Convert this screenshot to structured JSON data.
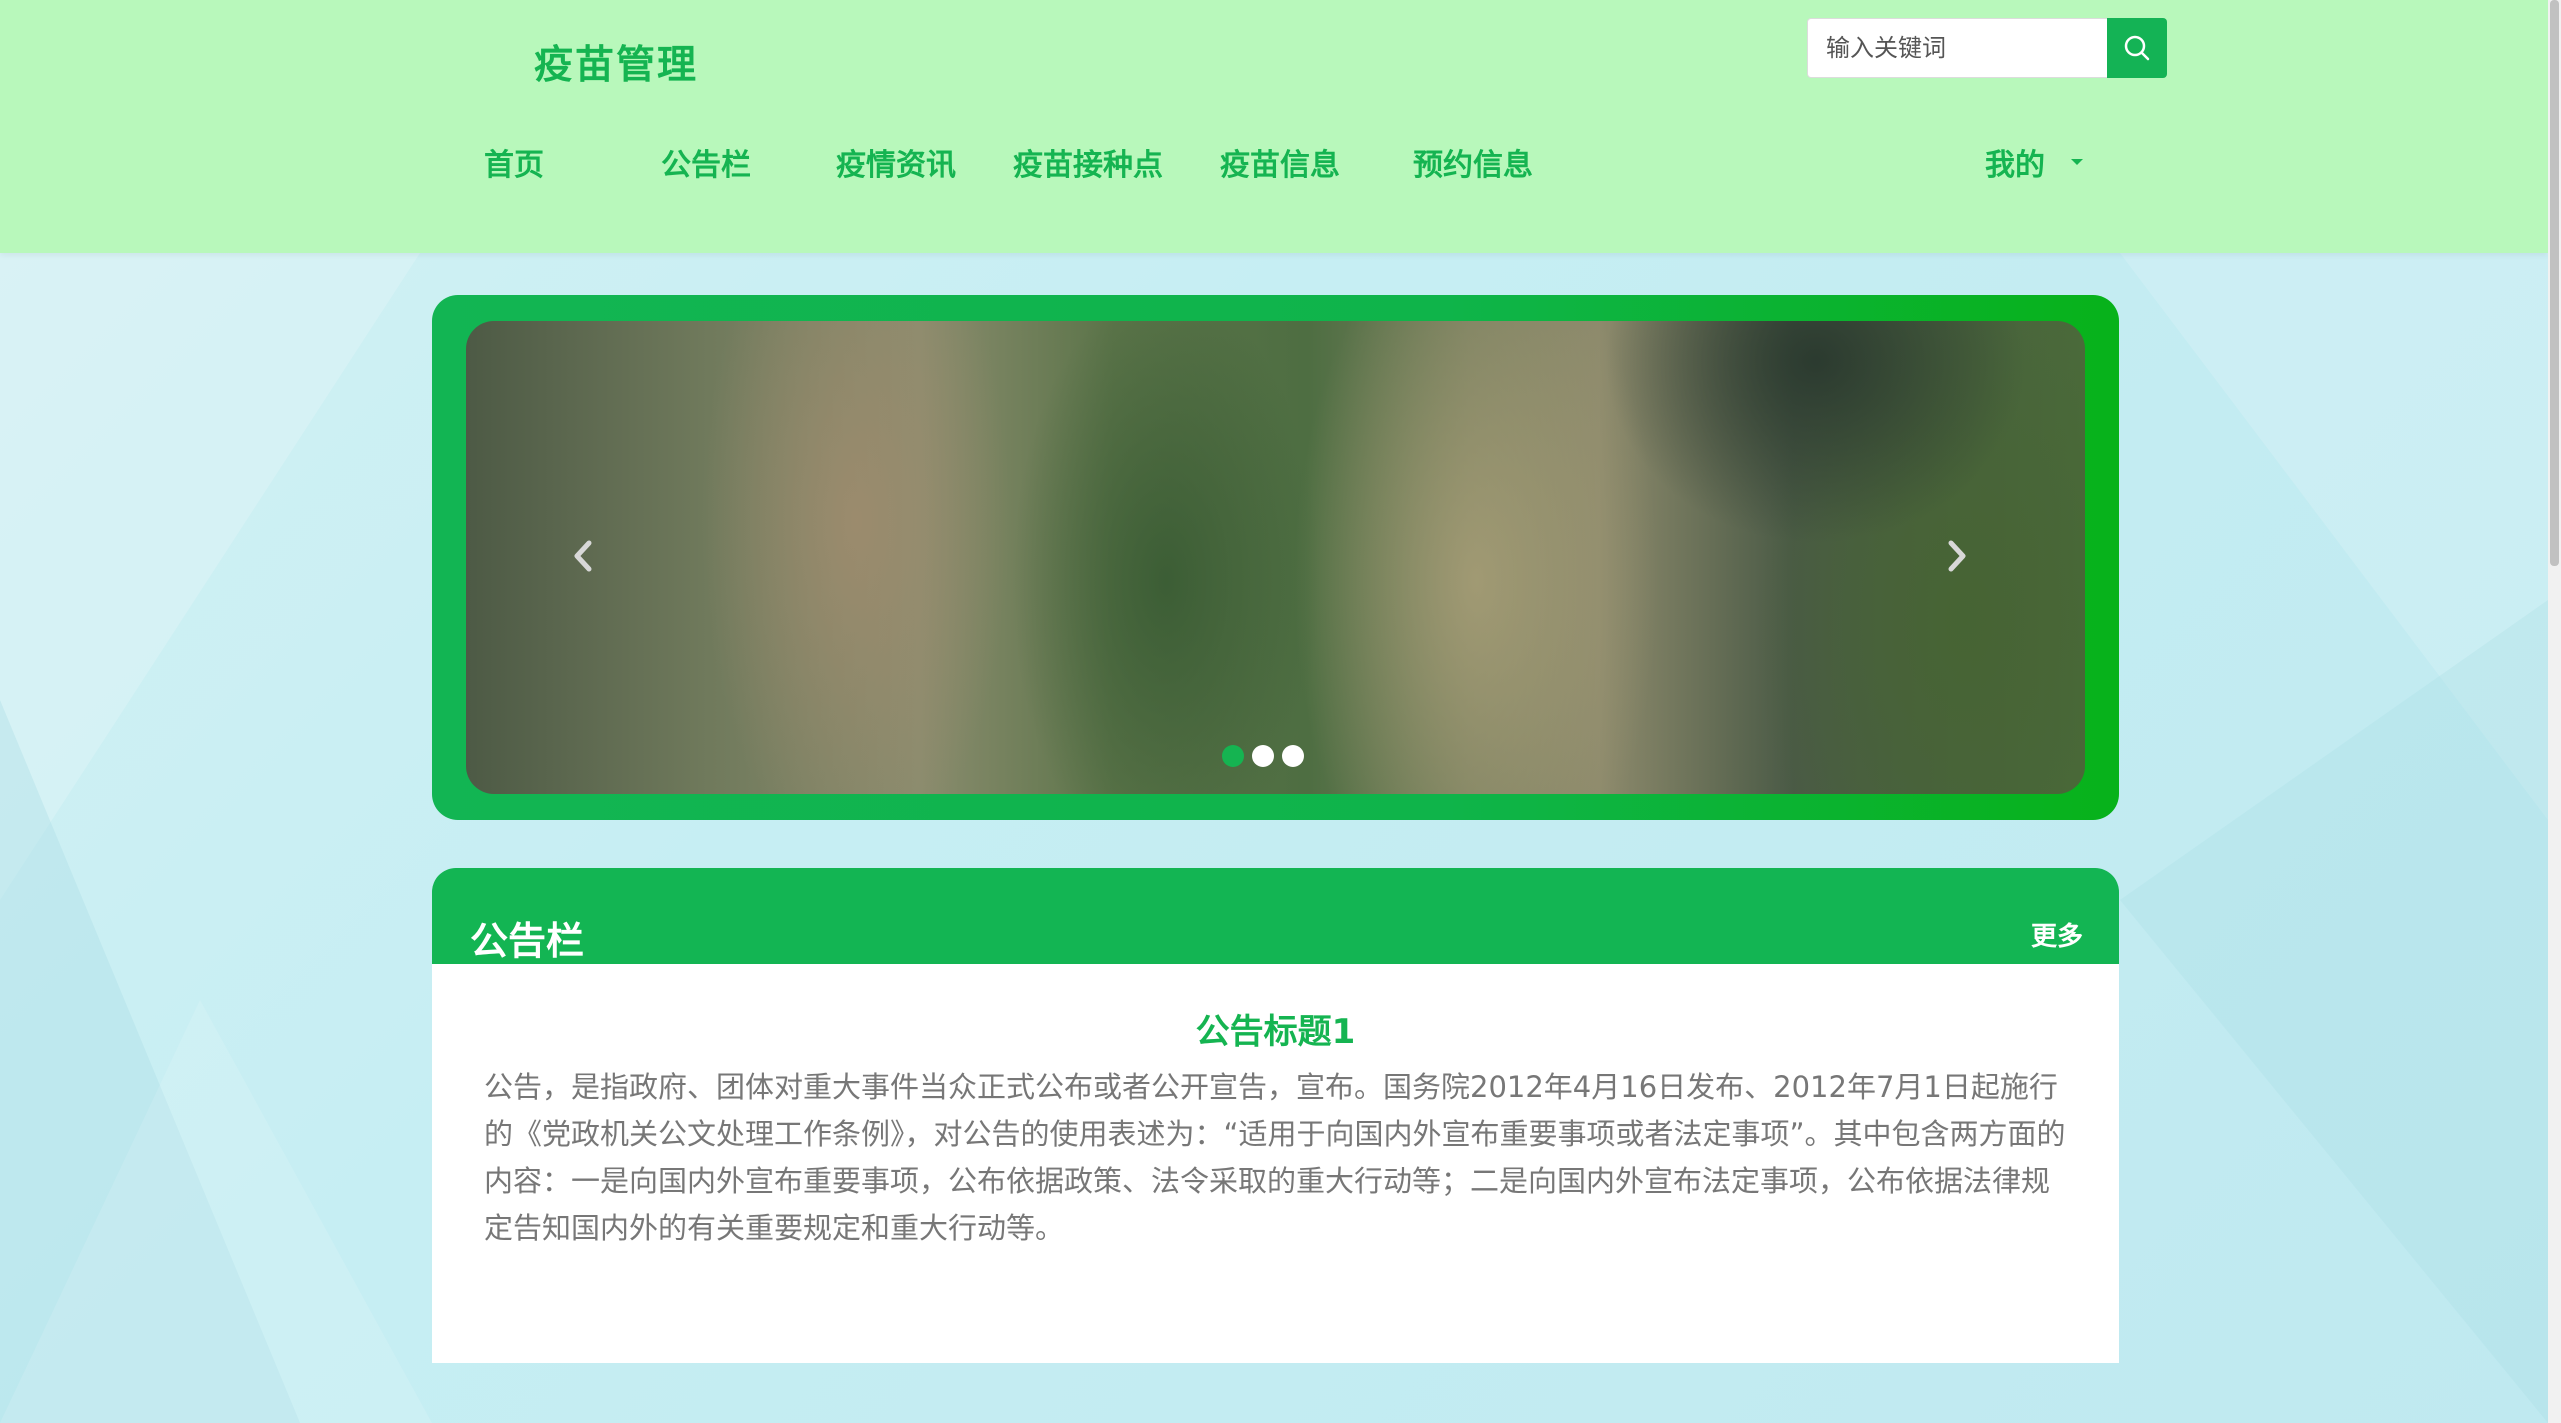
{
  "header": {
    "brand": "疫苗管理",
    "search": {
      "placeholder": "输入关键词",
      "value": "",
      "button_icon": "search-icon"
    },
    "nav": [
      {
        "label": "首页"
      },
      {
        "label": "公告栏"
      },
      {
        "label": "疫情资讯"
      },
      {
        "label": "疫苗接种点"
      },
      {
        "label": "疫苗信息"
      },
      {
        "label": "预约信息"
      }
    ],
    "user_menu": {
      "label": "我的",
      "icon": "caret-down-icon"
    }
  },
  "carousel": {
    "prev_icon": "chevron-left-icon",
    "next_icon": "chevron-right-icon",
    "slides_count": 3,
    "active_index": 0
  },
  "notice_board": {
    "title": "公告栏",
    "more_label": "更多",
    "item": {
      "title": "公告标题1",
      "text": "公告，是指政府、团体对重大事件当众正式公布或者公开宣告，宣布。国务院2012年4月16日发布、2012年7月1日起施行的《党政机关公文处理工作条例》，对公告的使用表述为：“适用于向国内外宣布重要事项或者法定事项”。其中包含两方面的内容：一是向国内外宣布重要事项，公布依据政策、法令采取的重大行动等；二是向国内外宣布法定事项，公布依据法律规定告知国内外的有关重要规定和重大行动等。"
    }
  },
  "colors": {
    "accent": "#15b451",
    "header_bg": "#b8f8bb",
    "page_bg": "#c6eef3",
    "muted_text": "#777777"
  }
}
